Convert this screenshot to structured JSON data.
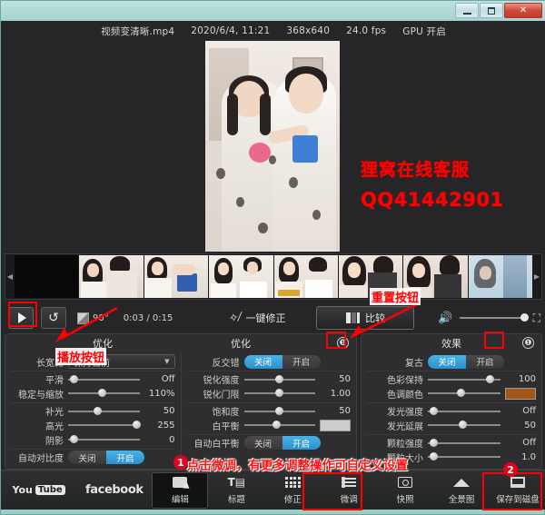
{
  "window": {
    "controls": {
      "minimize": "—",
      "maximize": "❐",
      "close": "✕"
    }
  },
  "infobar": {
    "filename": "视频变清晰.mp4",
    "datetime": "2020/6/4, 11:21",
    "resolution": "368x640",
    "fps": "24.0 fps",
    "gpu": "GPU 开启"
  },
  "watermark": {
    "line1": "狸窝在线客服",
    "line2": "QQ41442901"
  },
  "filmstrip": {
    "left_arrow": "◀",
    "right_arrow": "▶",
    "frames": [
      {
        "name": "frame-1"
      },
      {
        "name": "frame-2"
      },
      {
        "name": "frame-3"
      },
      {
        "name": "frame-4"
      },
      {
        "name": "frame-5"
      },
      {
        "name": "frame-6"
      },
      {
        "name": "frame-7"
      },
      {
        "name": "frame-8"
      }
    ]
  },
  "transport": {
    "play_icon": "play-icon",
    "reset_icon": "↺",
    "rotate_label": "90°",
    "time": "0:03 / 0:15",
    "fix_one_click": "一键修正",
    "compare": "比较",
    "volume_icon": "speaker-icon",
    "fullscreen_icon": "fullscreen-icon"
  },
  "panel_optimize": {
    "title": "优化",
    "info_icon": "①",
    "left_column": [
      {
        "label": "长宽比",
        "type": "combo",
        "value": "保持当前"
      },
      {
        "label": "平滑",
        "type": "slider",
        "value": "Off",
        "pos": 2
      },
      {
        "label": "稳定与缩放",
        "type": "slider",
        "value": "110%",
        "pos": 42
      },
      {
        "label": "补光",
        "type": "slider",
        "value": "50",
        "pos": 36
      },
      {
        "label": "高光",
        "type": "slider",
        "value": "255",
        "pos": 92
      },
      {
        "label": "阴影",
        "type": "slider",
        "value": "0",
        "pos": 2
      },
      {
        "label": "自动对比度",
        "type": "toggle",
        "off": "关闭",
        "on": "开启",
        "state": "on"
      }
    ],
    "mid_column": [
      {
        "label": "反交错",
        "type": "toggle",
        "off": "关闭",
        "on": "开启",
        "state": "off"
      },
      {
        "label": "锐化强度",
        "type": "slider",
        "value": "50",
        "pos": 44
      },
      {
        "label": "锐化门限",
        "type": "slider",
        "value": "1.00",
        "pos": 44
      },
      {
        "label": "饱和度",
        "type": "slider",
        "value": "50",
        "pos": 44
      },
      {
        "label": "白平衡",
        "type": "swatch",
        "value": "#cdcdcd",
        "pos": 40
      },
      {
        "label": "自动白平衡",
        "type": "toggle",
        "off": "关闭",
        "on": "开启",
        "state": "on"
      }
    ]
  },
  "panel_effects": {
    "title": "效果",
    "info_icon": "①",
    "rows": [
      {
        "label": "复古",
        "type": "toggle",
        "off": "关闭",
        "on": "开启",
        "state": "off"
      },
      {
        "label": "色彩保持",
        "type": "slider",
        "value": "100",
        "pos": 80
      },
      {
        "label": "色调颜色",
        "type": "swatch",
        "value": "#a1561a",
        "pos": 40
      },
      {
        "label": "发光强度",
        "type": "slider",
        "value": "Off",
        "pos": 2
      },
      {
        "label": "发光延展",
        "type": "slider",
        "value": "50",
        "pos": 42
      },
      {
        "label": "颗粒强度",
        "type": "slider",
        "value": "Off",
        "pos": 2
      },
      {
        "label": "颗粒大小",
        "type": "slider",
        "value": "1.0",
        "pos": 2
      }
    ]
  },
  "bottom_nav": [
    {
      "label": "",
      "icon": "youtube-logo",
      "name": "nav-youtube",
      "brand": true,
      "active": false
    },
    {
      "label": "facebook",
      "icon": "facebook-logo",
      "name": "nav-facebook",
      "brand": true,
      "active": false
    },
    {
      "label": "编辑",
      "icon": "edit-icon",
      "name": "nav-edit",
      "brand": false,
      "active": true
    },
    {
      "label": "标题",
      "icon": "title-icon",
      "name": "nav-title",
      "brand": false,
      "active": false
    },
    {
      "label": "修正",
      "icon": "correct-icon",
      "name": "nav-correct",
      "brand": false,
      "active": false
    },
    {
      "label": "微调",
      "icon": "tune-icon",
      "name": "nav-tune",
      "brand": false,
      "active": false
    },
    {
      "label": "快照",
      "icon": "snapshot-icon",
      "name": "nav-snapshot",
      "brand": false,
      "active": false
    },
    {
      "label": "全景图",
      "icon": "panorama-icon",
      "name": "nav-panorama",
      "brand": false,
      "active": false
    },
    {
      "label": "保存到磁盘",
      "icon": "save-disk-icon",
      "name": "nav-save-disk",
      "brand": false,
      "active": false
    }
  ],
  "annotations": {
    "play_button_label": "播放按钮",
    "reset_button_label": "重置按钮",
    "tip_text": "点击微调，有更多调整操作可自定义设置",
    "badge_one": "1",
    "badge_two": "2"
  },
  "youtube_logo": {
    "text": "You",
    "box": "Tube"
  },
  "colors": {
    "accent_blue": "#2b8fcb",
    "annotation_red": "#ff0000",
    "panel_bg": "#2e2e30",
    "content_bg": "#262628",
    "title_bg": "#a5d2cd"
  }
}
